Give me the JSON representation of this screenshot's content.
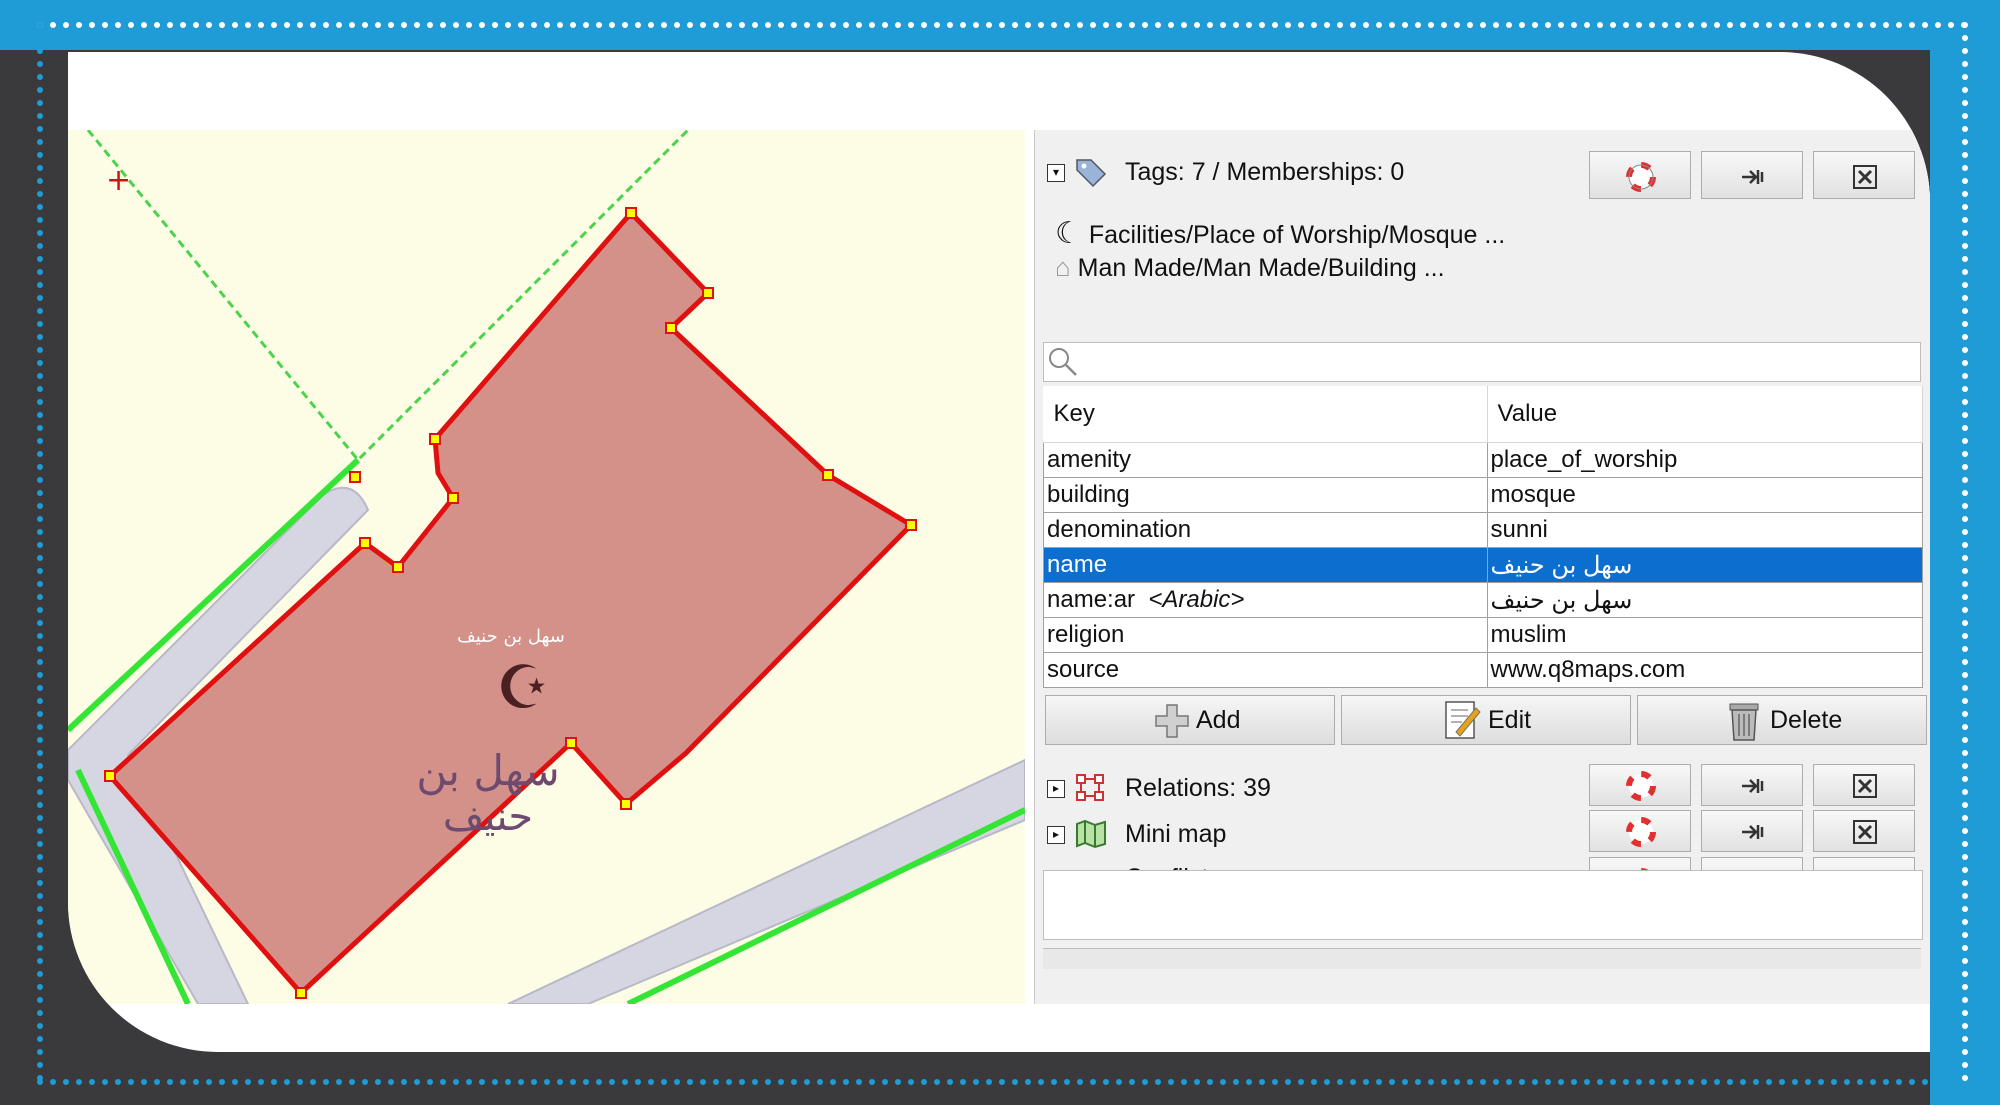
{
  "map": {
    "labels": {
      "small_name": "سهل بن حنيف",
      "large_name_line1": "سهل بن",
      "large_name_line2": "حنيف"
    },
    "colors": {
      "building_fill": "#d4918a",
      "outline": "#e01010",
      "road": "#d6d6e2",
      "highway_line": "#35e535",
      "background": "#fdfde6"
    }
  },
  "tags_panel": {
    "title": "Tags: 7 / Memberships: 0",
    "icons": [
      "tag-icon",
      "help-icon",
      "pin-icon",
      "close-icon"
    ],
    "presets": [
      {
        "label": "Facilities/Place of Worship/Mosque ...",
        "icon": "crescent-icon"
      },
      {
        "label": "Man Made/Man Made/Building ...",
        "icon": "building-icon"
      }
    ],
    "search_placeholder": "",
    "columns": {
      "key": "Key",
      "value": "Value"
    },
    "rows": [
      {
        "key": "amenity",
        "value": "place_of_worship"
      },
      {
        "key": "building",
        "value": "mosque"
      },
      {
        "key": "denomination",
        "value": "sunni"
      },
      {
        "key": "name",
        "value": "سهل بن حنيف",
        "selected": true
      },
      {
        "key": "name:ar",
        "key_hint": "<Arabic>",
        "value": "سهل بن حنيف"
      },
      {
        "key": "religion",
        "value": "muslim"
      },
      {
        "key": "source",
        "value": "www.q8maps.com"
      }
    ],
    "buttons": {
      "add": "Add",
      "edit": "Edit",
      "delete": "Delete"
    }
  },
  "relations_panel": {
    "title": "Relations: 39"
  },
  "minimap_panel": {
    "title": "Mini map"
  },
  "conflict_panel": {
    "title": "Conflict"
  },
  "theme": {
    "frame_blue": "#1f9bd6",
    "frame_dark": "#3a3a3c",
    "selection": "#0c6fd0"
  }
}
